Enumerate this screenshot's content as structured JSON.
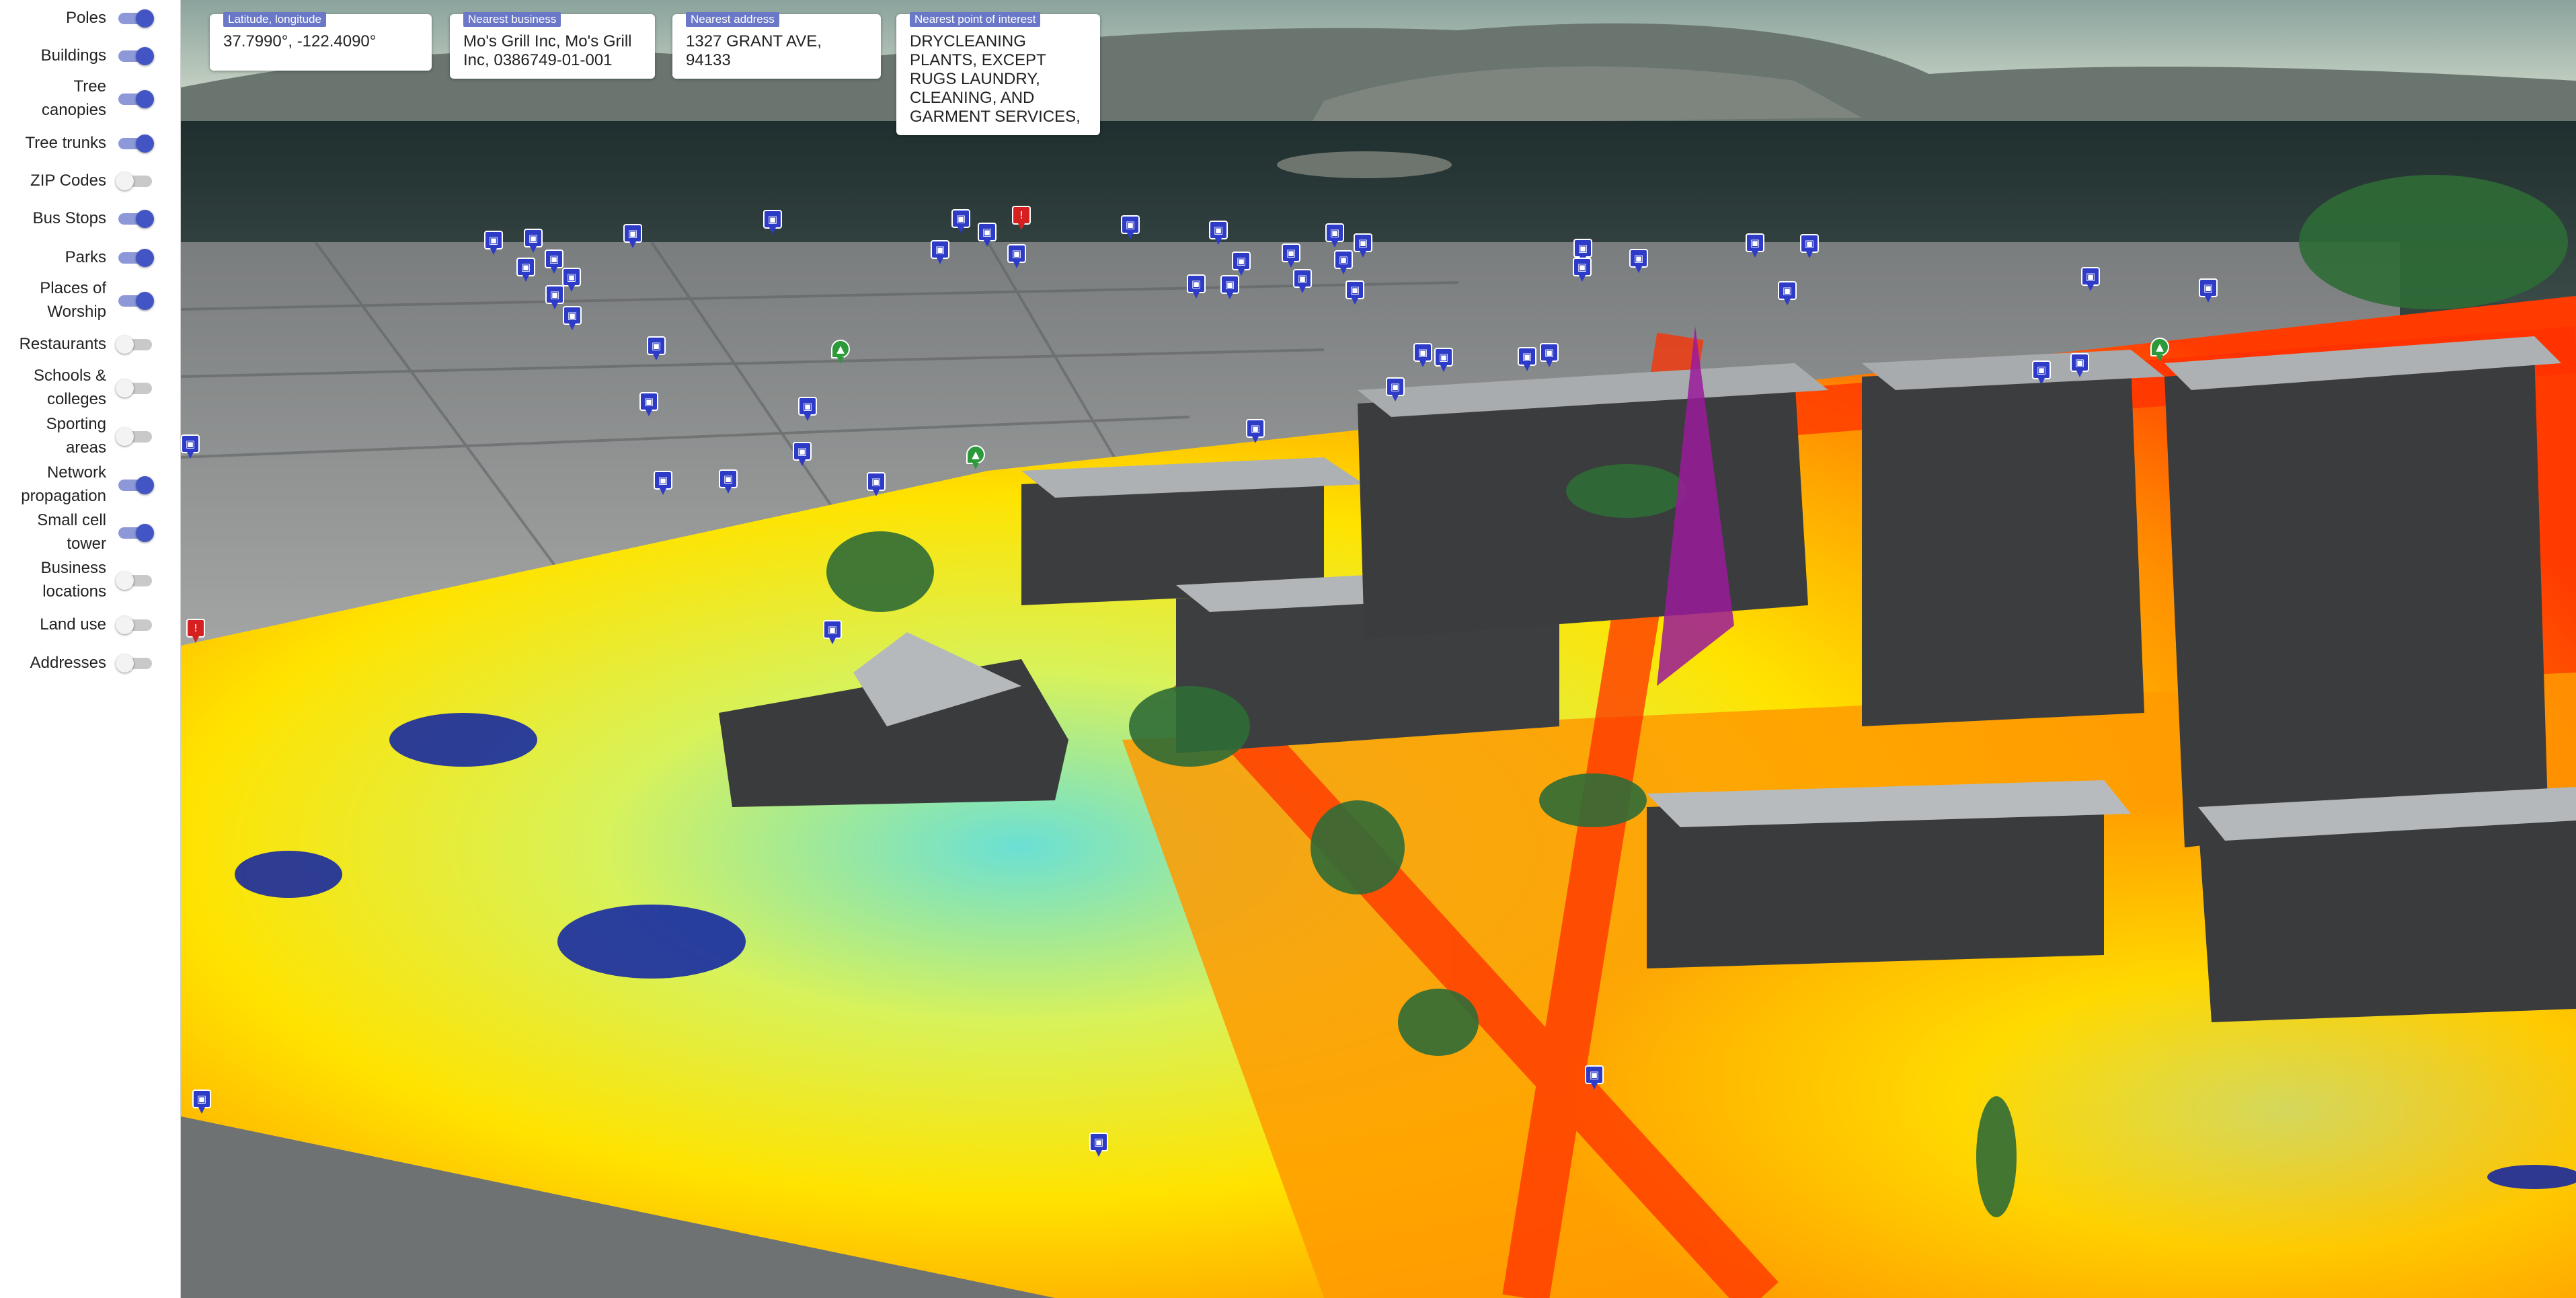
{
  "sidebar": {
    "layers": [
      {
        "label": "Poles",
        "on": true
      },
      {
        "label": "Buildings",
        "on": true
      },
      {
        "label": "Tree\ncanopies",
        "on": true
      },
      {
        "label": "Tree trunks",
        "on": true
      },
      {
        "label": "ZIP Codes",
        "on": false
      },
      {
        "label": "Bus Stops",
        "on": true
      },
      {
        "label": "Parks",
        "on": true
      },
      {
        "label": "Places of\nWorship",
        "on": true
      },
      {
        "label": "Restaurants",
        "on": false
      },
      {
        "label": "Schools &\ncolleges",
        "on": false
      },
      {
        "label": "Sporting\nareas",
        "on": false
      },
      {
        "label": "Network\npropagation",
        "on": true
      },
      {
        "label": "Small cell\ntower",
        "on": true
      },
      {
        "label": "Business\nlocations",
        "on": false
      },
      {
        "label": "Land use",
        "on": false
      },
      {
        "label": "Addresses",
        "on": false
      }
    ]
  },
  "info": {
    "coords": {
      "tag": "Latitude, longitude",
      "value": "37.7990°, -122.4090°"
    },
    "business": {
      "tag": "Nearest business",
      "value": "Mo's Grill Inc, Mo's Grill Inc, 0386749-01-001"
    },
    "address": {
      "tag": "Nearest address",
      "value": "1327 GRANT AVE, 94133"
    },
    "poi": {
      "tag": "Nearest point of interest",
      "value": "DRYCLEANING PLANTS, EXCEPT RUGS LAUNDRY, CLEANING, AND GARMENT SERVICES,"
    }
  },
  "colors": {
    "toggle_on": "#4355c4",
    "toggle_off": "#c9c9c9",
    "bus_stop": "#2d3bc6",
    "poi_marker": "#d62020",
    "park_marker": "#2c9a3a",
    "tower_cone": "#9a1a9a",
    "heat_high": "#ff2a00",
    "heat_mid": "#ffd400",
    "heat_low": "#58d6d6"
  },
  "markers": {
    "bus_stop_icon": "bus-icon",
    "poi_icon": "info-pin-icon",
    "park_icon": "tree-pin-icon"
  }
}
